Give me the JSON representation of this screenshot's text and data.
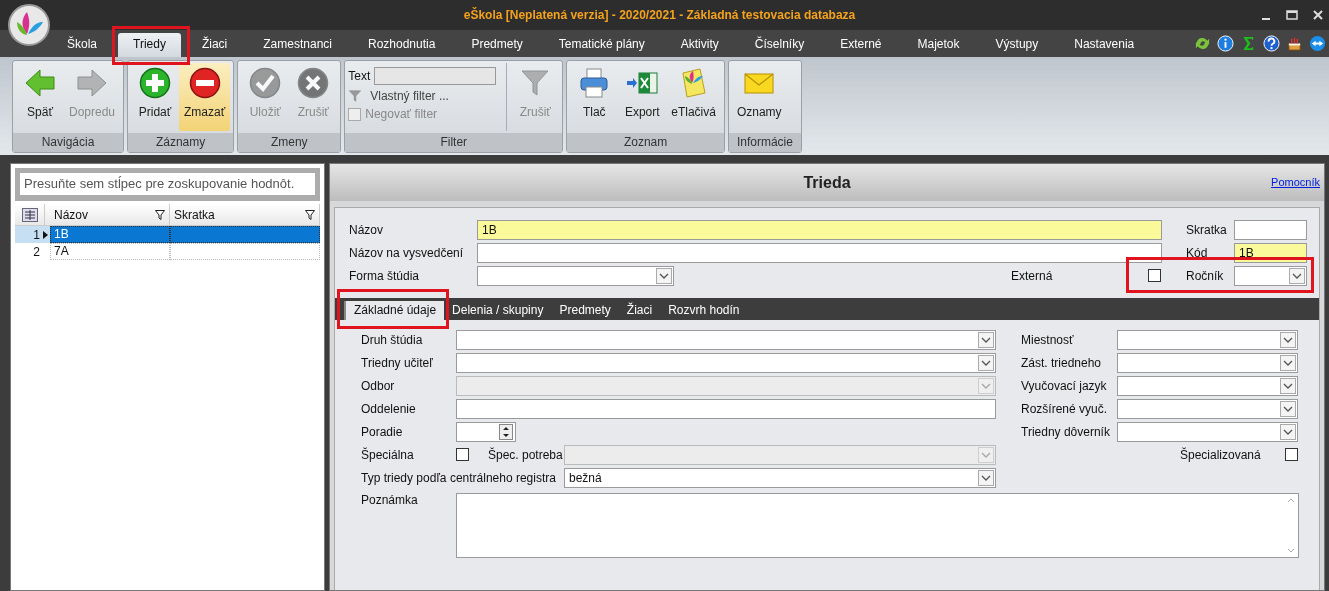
{
  "window": {
    "title": "eŠkola [Neplatená verzia] - 2020/2021 - Základná testovacia databaza"
  },
  "menu": [
    {
      "label": "Škola",
      "selected": false,
      "highlighted": false
    },
    {
      "label": "Triedy",
      "selected": true,
      "highlighted": true
    },
    {
      "label": "Žiaci",
      "selected": false,
      "highlighted": false
    },
    {
      "label": "Zamestnanci",
      "selected": false,
      "highlighted": false
    },
    {
      "label": "Rozhodnutia",
      "selected": false,
      "highlighted": false
    },
    {
      "label": "Predmety",
      "selected": false,
      "highlighted": false
    },
    {
      "label": "Tematické plány",
      "selected": false,
      "highlighted": false
    },
    {
      "label": "Aktivity",
      "selected": false,
      "highlighted": false
    },
    {
      "label": "Číselníky",
      "selected": false,
      "highlighted": false
    },
    {
      "label": "Externé",
      "selected": false,
      "highlighted": false
    },
    {
      "label": "Majetok",
      "selected": false,
      "highlighted": false
    },
    {
      "label": "Výstupy",
      "selected": false,
      "highlighted": false
    },
    {
      "label": "Nastavenia",
      "selected": false,
      "highlighted": false
    }
  ],
  "ribbon": [
    {
      "label": "Navigácia",
      "items": [
        {
          "kind": "button",
          "label": "Späť",
          "disabled": false,
          "hovered": false
        },
        {
          "kind": "button",
          "label": "Dopredu",
          "disabled": true,
          "hovered": false
        }
      ]
    },
    {
      "label": "Záznamy",
      "items": [
        {
          "kind": "button",
          "label": "Pridať",
          "disabled": false,
          "hovered": false
        },
        {
          "kind": "button",
          "label": "Zmazať",
          "disabled": false,
          "hovered": true
        }
      ]
    },
    {
      "label": "Zmeny",
      "items": [
        {
          "kind": "button",
          "label": "Uložiť",
          "disabled": true,
          "hovered": false
        },
        {
          "kind": "button",
          "label": "Zrušiť",
          "disabled": true,
          "hovered": false
        }
      ]
    },
    {
      "label": "Filter",
      "items": [
        {
          "kind": "text",
          "label": "Text"
        },
        {
          "kind": "link",
          "label": "Vlastný filter ..."
        },
        {
          "kind": "check",
          "label": "Negovať filter",
          "checked": false,
          "disabled": true
        },
        {
          "kind": "button",
          "label": "Zrušiť",
          "disabled": true,
          "hovered": false
        }
      ]
    },
    {
      "label": "Zoznam",
      "items": [
        {
          "kind": "button",
          "label": "Tlač",
          "disabled": false,
          "hovered": false
        },
        {
          "kind": "button",
          "label": "Export",
          "disabled": false,
          "hovered": false
        },
        {
          "kind": "button",
          "label": "eTlačivá",
          "disabled": false,
          "hovered": false
        }
      ]
    },
    {
      "label": "Informácie",
      "items": [
        {
          "kind": "button",
          "label": "Oznamy",
          "disabled": false,
          "hovered": false
        }
      ]
    }
  ],
  "group_hint": "Presuňte sem stĺpec pre zoskupovanie hodnôt.",
  "grid": {
    "columns": [
      "Názov",
      "Skratka"
    ],
    "rows": [
      {
        "number": "1",
        "name": "1B",
        "selected": true
      },
      {
        "number": "2",
        "name": "7A",
        "selected": false
      }
    ]
  },
  "detail": {
    "title": "Trieda",
    "help_link": "Pomocník",
    "header_left": [
      {
        "kind": "text",
        "label": "Názov",
        "value": "1B",
        "required": true
      },
      {
        "kind": "text",
        "label": "Názov na vysvedčení",
        "required": false
      },
      {
        "kind": "combo",
        "label": "Forma štúdia",
        "disabled": false,
        "check": {
          "label": "Externá",
          "checked": false
        }
      }
    ],
    "header_right": [
      {
        "kind": "text",
        "label": "Skratka",
        "required": false,
        "highlighted": false
      },
      {
        "kind": "text",
        "label": "Kód",
        "value": "1B",
        "required": true,
        "highlighted": false
      },
      {
        "kind": "combo",
        "label": "Ročník",
        "disabled": false,
        "highlighted": true
      }
    ],
    "tabs": [
      {
        "label": "Základné údaje",
        "selected": true,
        "highlighted": true
      },
      {
        "label": "Delenia / skupiny",
        "selected": false,
        "highlighted": false
      },
      {
        "label": "Predmety",
        "selected": false,
        "highlighted": false
      },
      {
        "label": "Žiaci",
        "selected": false,
        "highlighted": false
      },
      {
        "label": "Rozvrh hodín",
        "selected": false,
        "highlighted": false
      }
    ],
    "left_rows": [
      {
        "fields": [
          {
            "kind": "combo",
            "label": "Druh štúdia",
            "disabled": false
          }
        ]
      },
      {
        "fields": [
          {
            "kind": "combo",
            "label": "Triedny učiteľ",
            "disabled": false
          }
        ]
      },
      {
        "fields": [
          {
            "kind": "combo",
            "label": "Odbor",
            "disabled": true
          }
        ]
      },
      {
        "fields": [
          {
            "kind": "text",
            "label": "Oddelenie",
            "required": false
          }
        ]
      },
      {
        "fields": [
          {
            "kind": "spin",
            "label": "Poradie"
          }
        ]
      },
      {
        "fields": [
          {
            "kind": "check",
            "label": "Špeciálna",
            "checked": false
          },
          {
            "kind": "combo",
            "label": "Špec. potreba",
            "disabled": true
          }
        ]
      },
      {
        "fields": [
          {
            "kind": "combo",
            "label": "Typ triedy podľa centrálneho registra",
            "value": "bežná",
            "disabled": false
          }
        ]
      }
    ],
    "right_rows": [
      {
        "kind": "combo",
        "label": "Miestnosť",
        "disabled": false
      },
      {
        "kind": "combo",
        "label": "Zást. triedneho",
        "disabled": false
      },
      {
        "kind": "combo",
        "label": "Vyučovací jazyk",
        "disabled": false
      },
      {
        "kind": "combo",
        "label": "Rozšírené vyuč.",
        "disabled": false
      },
      {
        "kind": "combo",
        "label": "Triedny dôverník",
        "disabled": false
      },
      {
        "kind": "check",
        "label": "Špecializovaná",
        "checked": false
      }
    ],
    "note": {
      "label": "Poznámka"
    }
  }
}
